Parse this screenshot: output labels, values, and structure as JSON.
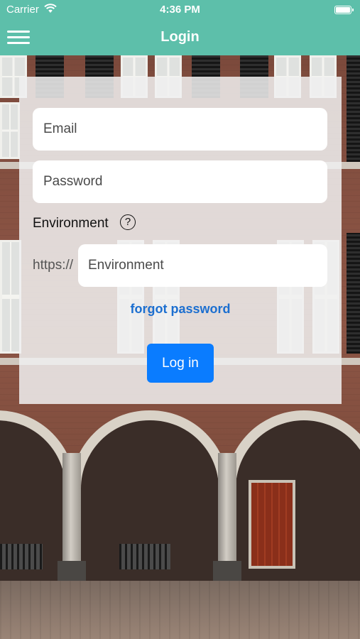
{
  "status_bar": {
    "carrier": "Carrier",
    "time": "4:36 PM"
  },
  "nav_bar": {
    "title": "Login"
  },
  "login_form": {
    "email_placeholder": "Email",
    "password_placeholder": "Password",
    "environment_label": "Environment",
    "help_symbol": "?",
    "url_prefix": "https://",
    "environment_placeholder": "Environment",
    "forgot_password_label": "forgot password",
    "login_button_label": "Log in"
  },
  "colors": {
    "nav_background": "#5dbfaa",
    "link": "#1c6fd0",
    "primary_button": "#0a7cff"
  },
  "icons": {
    "menu": "hamburger-menu-icon",
    "wifi": "wifi-icon",
    "battery": "battery-icon",
    "help": "help-circle-icon"
  }
}
